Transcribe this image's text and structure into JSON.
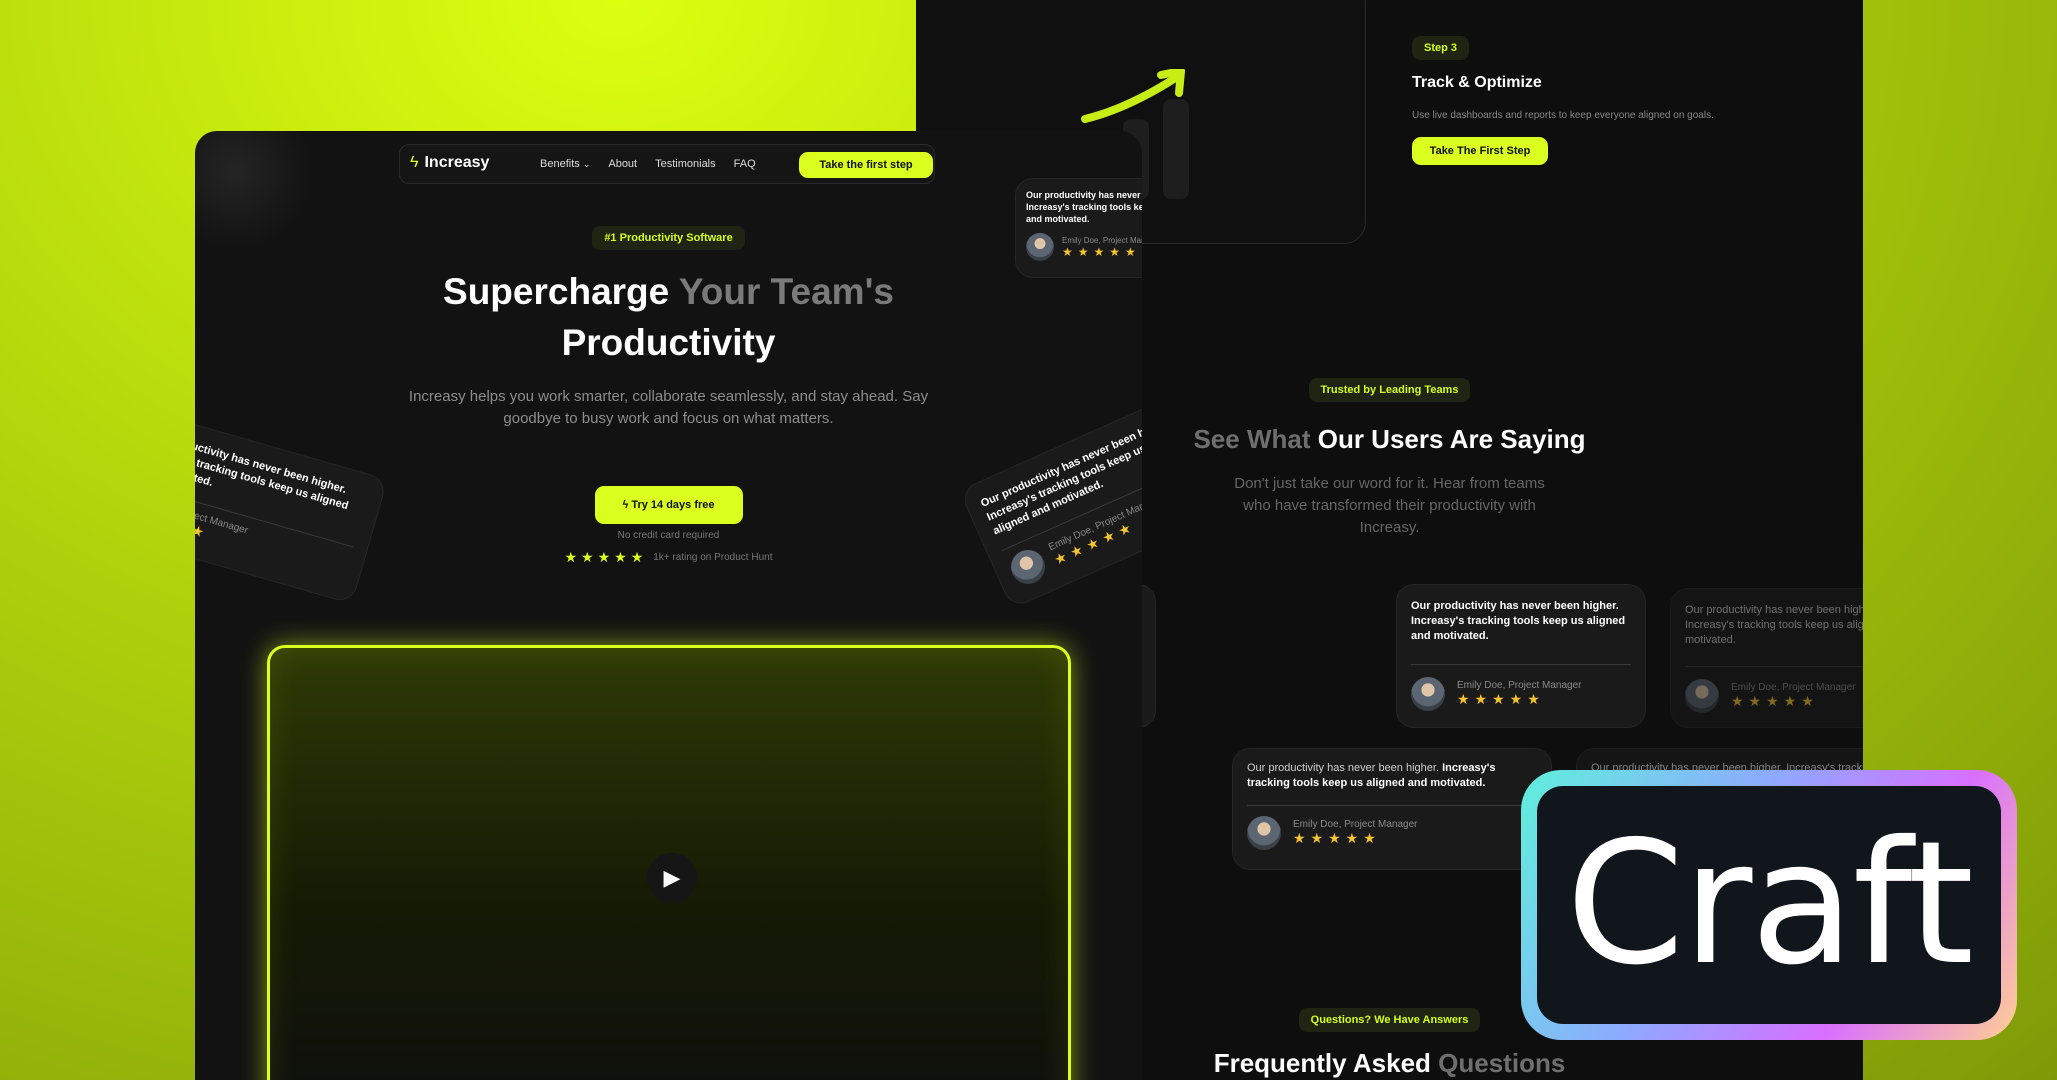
{
  "nav": {
    "brand": "Increasy",
    "links": [
      "Benefits",
      "About",
      "Testimonials",
      "FAQ"
    ],
    "cta": "Take the first step"
  },
  "hero": {
    "badge": "#1 Productivity Software",
    "title_a": "Supercharge",
    "title_b": "Your Team's",
    "title_c": "Productivity",
    "subtitle": "Increasy helps you work smarter, collaborate seamlessly, and stay ahead. Say goodbye to busy work and focus on what matters.",
    "cta": "Try 14 days free",
    "note": "No credit card required",
    "rating": "1k+ rating on Product Hunt"
  },
  "testimonial": {
    "quote_a": "Our productivity has never been higher.",
    "quote_b": "Increasy's tracking tools keep us aligned and motivated.",
    "author": "Emily Doe, Project Manager",
    "rating": 5
  },
  "step": {
    "label": "Step 3",
    "title": "Track & Optimize",
    "desc": "Use live dashboards and reports to keep everyone aligned on goals.",
    "cta": "Take The First Step"
  },
  "testimonials_section": {
    "badge": "Trusted by Leading Teams",
    "title_a": "See What",
    "title_b": "Our Users Are Saying",
    "subtitle": "Don't just take our word for it. Hear from teams who have transformed their productivity with Increasy."
  },
  "faq": {
    "badge": "Questions? We Have Answers",
    "title_a": "Frequently Asked",
    "title_b": "Questions"
  },
  "overlay": {
    "label": "Craft"
  },
  "colors": {
    "accent": "#dbff1e",
    "bg": "#121212"
  }
}
